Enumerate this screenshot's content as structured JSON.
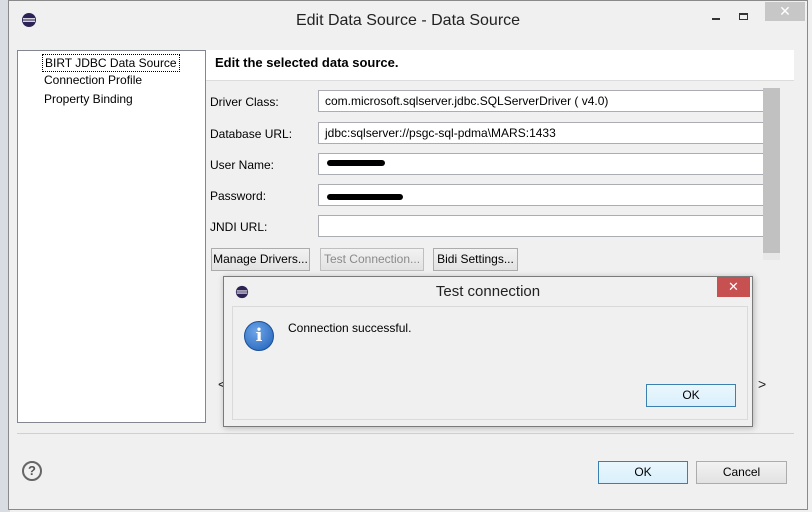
{
  "window": {
    "title": "Edit Data Source - Data Source",
    "controls": {
      "minimize_icon": "minimize-icon",
      "maximize_icon": "maximize-icon",
      "close_icon": "close-icon"
    }
  },
  "sidebar": {
    "items": [
      {
        "label": "BIRT JDBC Data Source",
        "selected": true
      },
      {
        "label": "Connection Profile",
        "selected": false
      },
      {
        "label": "Property Binding",
        "selected": false
      }
    ]
  },
  "content": {
    "heading": "Edit the selected data source.",
    "fields": {
      "driver_class": {
        "label": "Driver Class:",
        "value": "com.microsoft.sqlserver.jdbc.SQLServerDriver ( v4.0)"
      },
      "database_url": {
        "label": "Database URL:",
        "value": "jdbc:sqlserver://psgc-sql-pdma\\MARS:1433"
      },
      "user_name": {
        "label": "User Name:",
        "value": ""
      },
      "password": {
        "label": "Password:",
        "value": ""
      },
      "jndi_url": {
        "label": "JNDI URL:",
        "value": ""
      }
    },
    "buttons": {
      "manage_drivers": "Manage Drivers...",
      "test_connection": "Test Connection...",
      "bidi_settings": "Bidi Settings..."
    },
    "scroll_left": "<",
    "scroll_right": ">"
  },
  "footer": {
    "help": "?",
    "ok": "OK",
    "cancel": "Cancel"
  },
  "modal": {
    "title": "Test connection",
    "message": "Connection successful.",
    "ok": "OK",
    "close": "✕",
    "accent_close": "#c75050"
  }
}
